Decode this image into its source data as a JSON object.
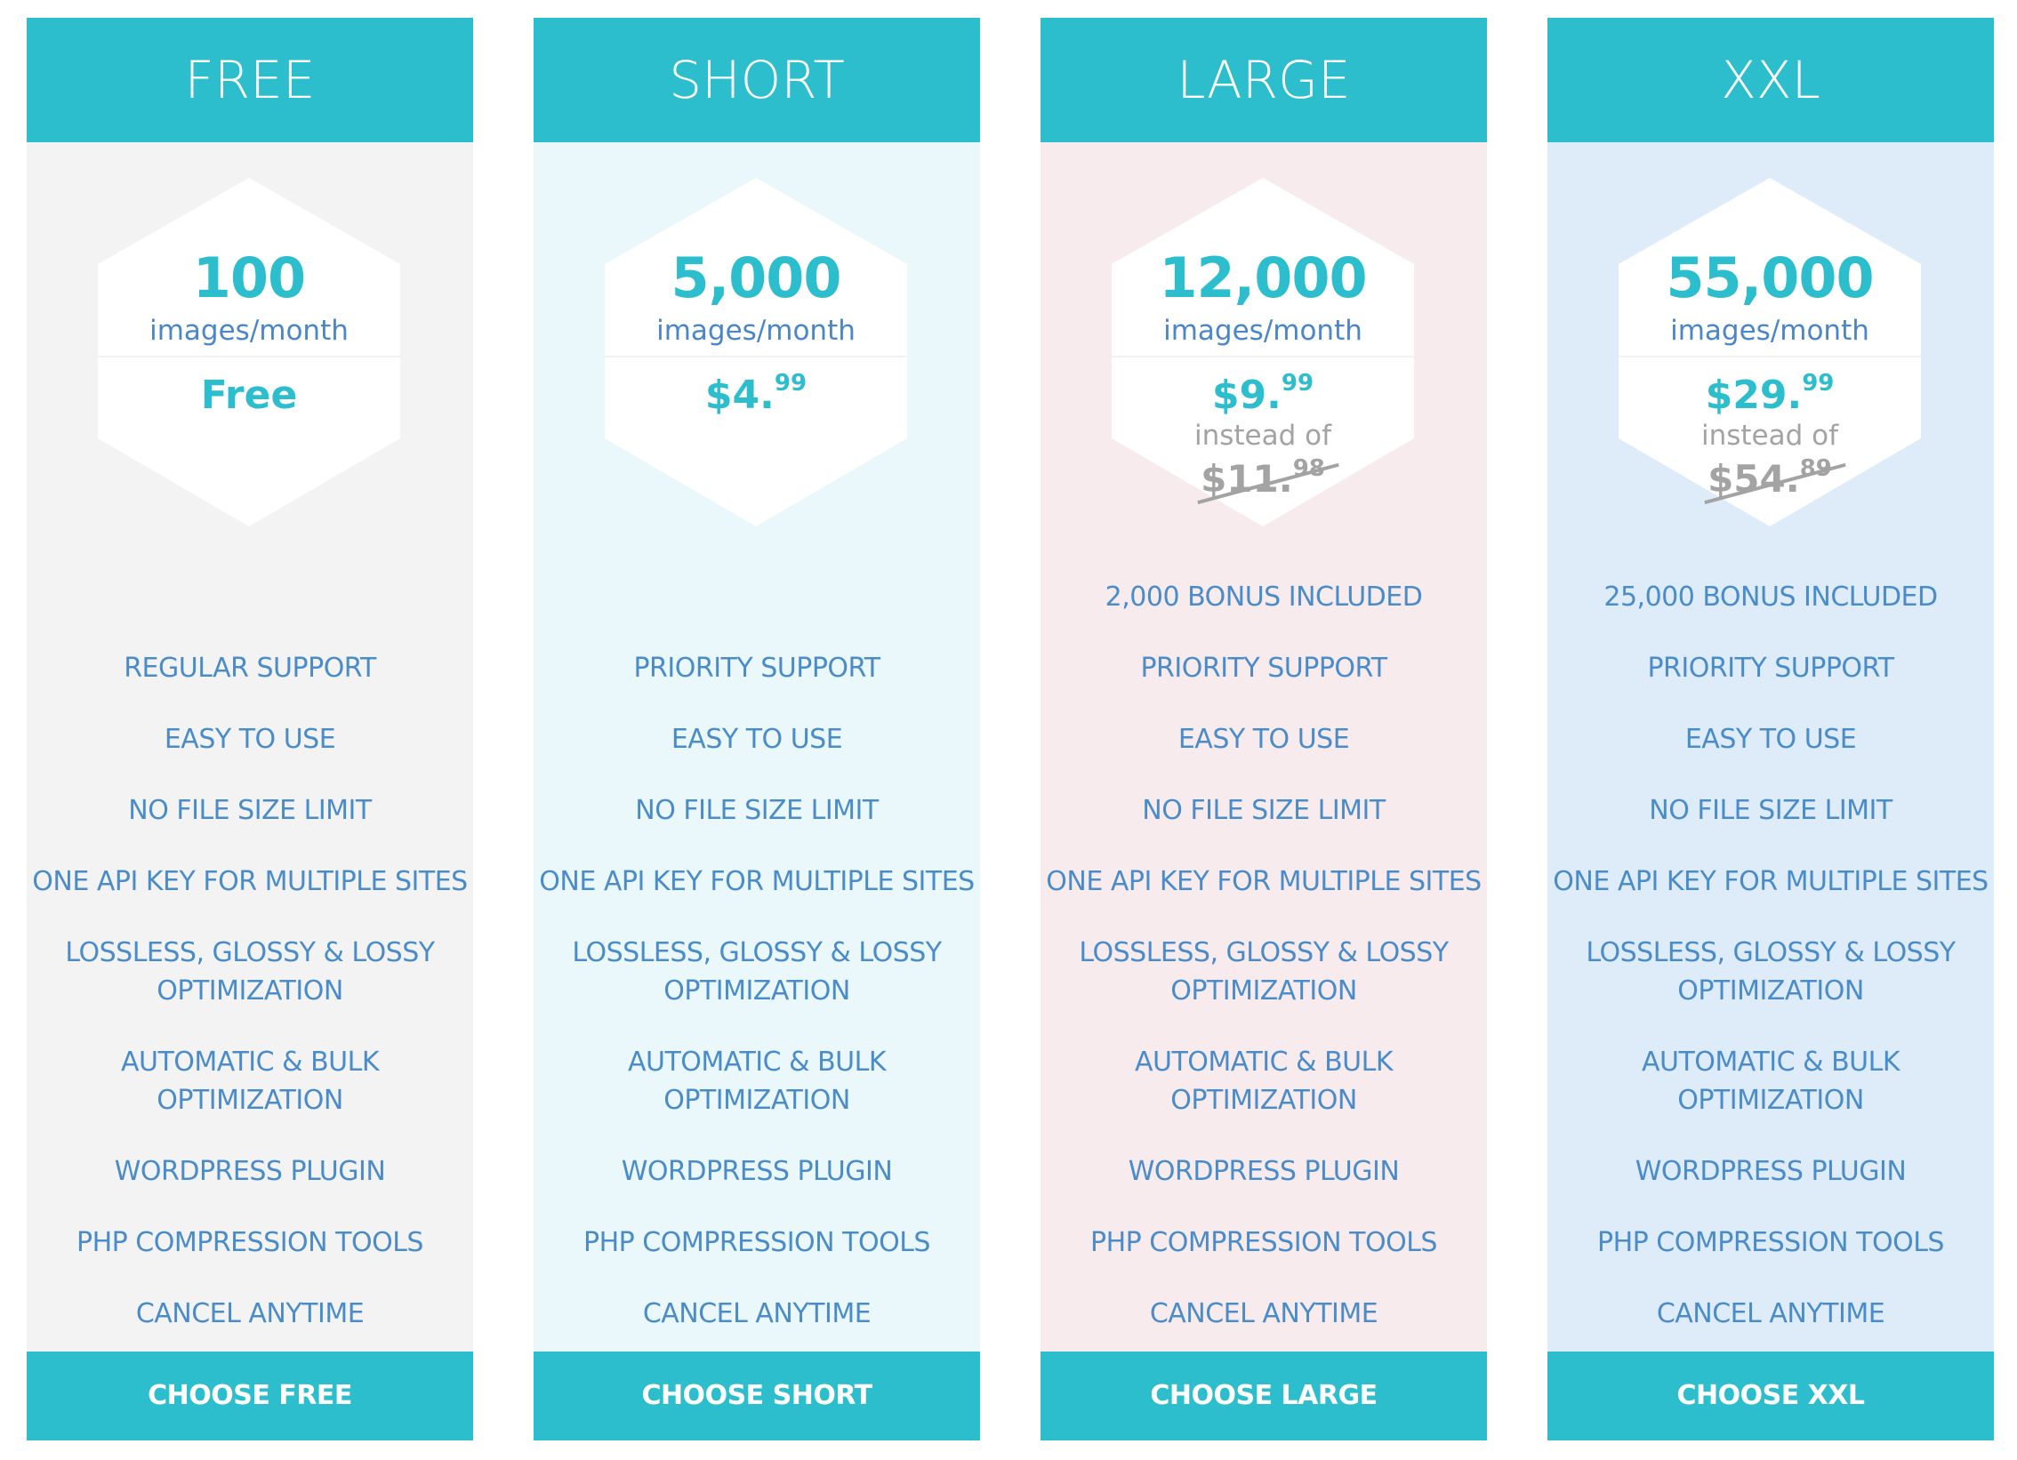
{
  "colors": {
    "accent": "#2dbecd",
    "feature_text": "#4a8cca",
    "muted_text": "#a3a3a3",
    "plan_backgrounds": [
      "#f3f3f3",
      "#eaf7fb",
      "#f8ebed",
      "#deebf8"
    ]
  },
  "plans": [
    {
      "name": "FREE",
      "count": "100",
      "unit": "images/month",
      "price_main": "Free",
      "price_cents": "",
      "instead_of": "",
      "old_price_main": "",
      "old_price_cents": "",
      "bonus": "",
      "features": [
        "REGULAR SUPPORT",
        "EASY TO USE",
        "NO FILE SIZE LIMIT",
        "ONE API KEY FOR MULTIPLE SITES",
        "LOSSLESS, GLOSSY & LOSSY\nOPTIMIZATION",
        "AUTOMATIC & BULK\nOPTIMIZATION",
        "WORDPRESS PLUGIN",
        "PHP COMPRESSION TOOLS",
        "CANCEL ANYTIME"
      ],
      "button_label": "CHOOSE FREE"
    },
    {
      "name": "SHORT",
      "count": "5,000",
      "unit": "images/month",
      "price_main": "$4.",
      "price_cents": "99",
      "instead_of": "",
      "old_price_main": "",
      "old_price_cents": "",
      "bonus": "",
      "features": [
        "PRIORITY SUPPORT",
        "EASY TO USE",
        "NO FILE SIZE LIMIT",
        "ONE API KEY FOR MULTIPLE SITES",
        "LOSSLESS, GLOSSY & LOSSY\nOPTIMIZATION",
        "AUTOMATIC & BULK\nOPTIMIZATION",
        "WORDPRESS PLUGIN",
        "PHP COMPRESSION TOOLS",
        "CANCEL ANYTIME"
      ],
      "button_label": "CHOOSE SHORT"
    },
    {
      "name": "LARGE",
      "count": "12,000",
      "unit": "images/month",
      "price_main": "$9.",
      "price_cents": "99",
      "instead_of": "instead of",
      "old_price_main": "$11.",
      "old_price_cents": "98",
      "bonus": "2,000 BONUS INCLUDED",
      "features": [
        "PRIORITY SUPPORT",
        "EASY TO USE",
        "NO FILE SIZE LIMIT",
        "ONE API KEY FOR MULTIPLE SITES",
        "LOSSLESS, GLOSSY & LOSSY\nOPTIMIZATION",
        "AUTOMATIC & BULK\nOPTIMIZATION",
        "WORDPRESS PLUGIN",
        "PHP COMPRESSION TOOLS",
        "CANCEL ANYTIME"
      ],
      "button_label": "CHOOSE LARGE"
    },
    {
      "name": "XXL",
      "count": "55,000",
      "unit": "images/month",
      "price_main": "$29.",
      "price_cents": "99",
      "instead_of": "instead of",
      "old_price_main": "$54.",
      "old_price_cents": "89",
      "bonus": "25,000 BONUS INCLUDED",
      "features": [
        "PRIORITY SUPPORT",
        "EASY TO USE",
        "NO FILE SIZE LIMIT",
        "ONE API KEY FOR MULTIPLE SITES",
        "LOSSLESS, GLOSSY & LOSSY\nOPTIMIZATION",
        "AUTOMATIC & BULK\nOPTIMIZATION",
        "WORDPRESS PLUGIN",
        "PHP COMPRESSION TOOLS",
        "CANCEL ANYTIME"
      ],
      "button_label": "CHOOSE XXL"
    }
  ]
}
